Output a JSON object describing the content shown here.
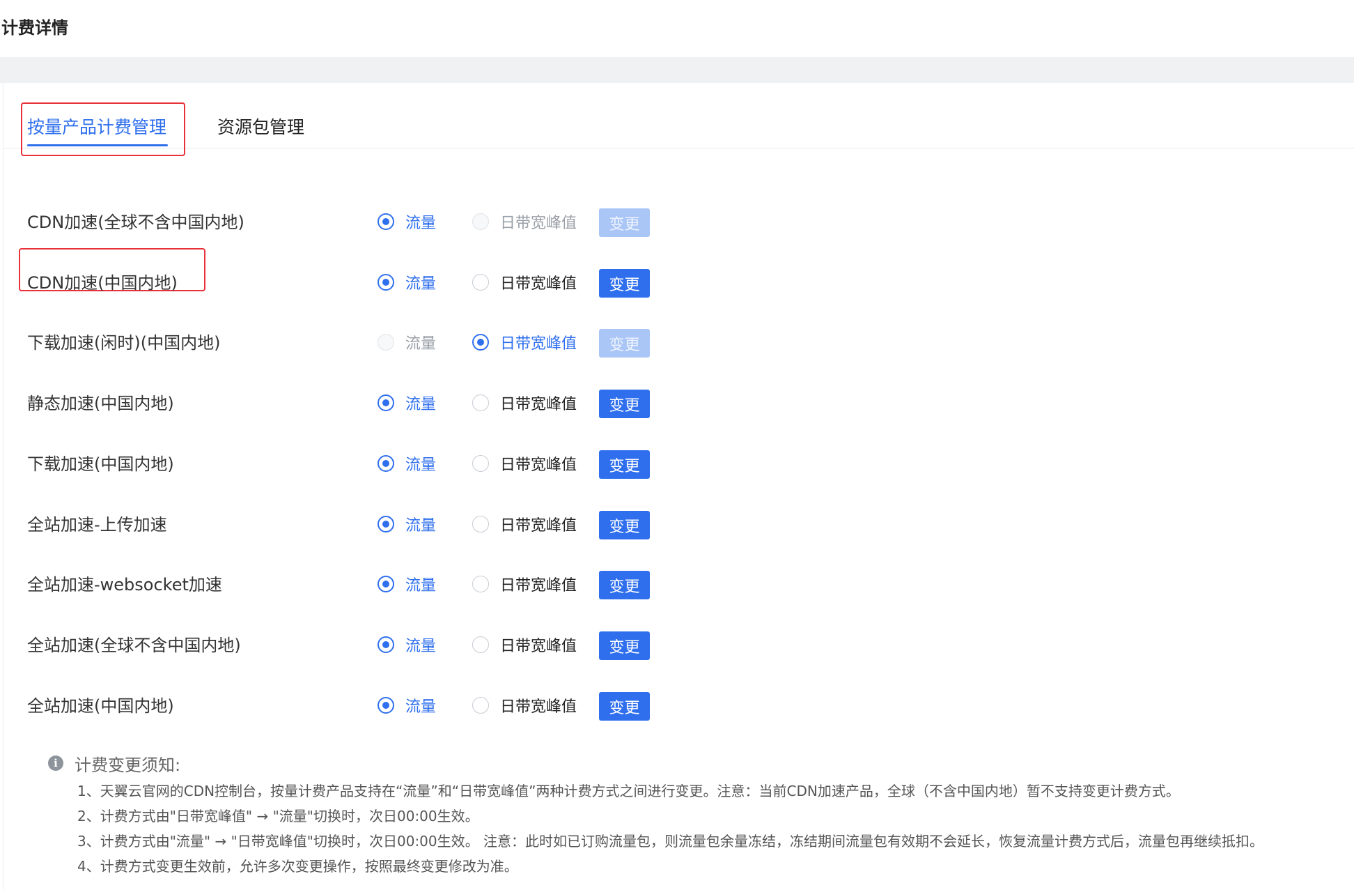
{
  "page": {
    "title": "计费详情"
  },
  "tabs": [
    {
      "label": "按量产品计费管理",
      "active": true
    },
    {
      "label": "资源包管理",
      "active": false
    }
  ],
  "options": {
    "traffic": "流量",
    "peak": "日带宽峰值",
    "change": "变更"
  },
  "rows": [
    {
      "label": "CDN加速(全球不含中国内地)",
      "selected": "traffic",
      "disabled": true
    },
    {
      "label": "CDN加速(中国内地)",
      "selected": "traffic",
      "disabled": false
    },
    {
      "label": "下载加速(闲时)(中国内地)",
      "selected": "peak",
      "disabled": true
    },
    {
      "label": "静态加速(中国内地)",
      "selected": "traffic",
      "disabled": false
    },
    {
      "label": "下载加速(中国内地)",
      "selected": "traffic",
      "disabled": false
    },
    {
      "label": "全站加速-上传加速",
      "selected": "traffic",
      "disabled": false
    },
    {
      "label": "全站加速-websocket加速",
      "selected": "traffic",
      "disabled": false
    },
    {
      "label": "全站加速(全球不含中国内地)",
      "selected": "traffic",
      "disabled": false
    },
    {
      "label": "全站加速(中国内地)",
      "selected": "traffic",
      "disabled": false
    }
  ],
  "notice": {
    "icon": "info-icon",
    "title": "计费变更须知:",
    "items": [
      "1、天翼云官网的CDN控制台，按量计费产品支持在“流量”和“日带宽峰值”两种计费方式之间进行变更。注意：当前CDN加速产品，全球（不含中国内地）暂不支持变更计费方式。",
      "2、计费方式由\"日带宽峰值\" → \"流量\"切换时，次日00:00生效。",
      "3、计费方式由\"流量\" → \"日带宽峰值\"切换时，次日00:00生效。 注意：此时如已订购流量包，则流量包余量冻结，冻结期间流量包有效期不会延长，恢复流量计费方式后，流量包再继续抵扣。",
      "4、计费方式变更生效前，允许多次变更操作，按照最终变更修改为准。"
    ]
  },
  "colors": {
    "primary": "#2f6fed",
    "primary_disabled": "#aac6f7",
    "highlight": "#e8313a"
  }
}
